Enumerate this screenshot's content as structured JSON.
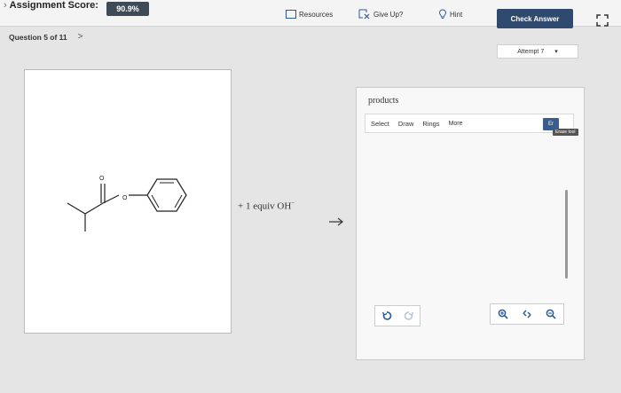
{
  "header": {
    "assignment_score_label": "Assignment Score:",
    "score": "90.9%",
    "resources_label": "Resources",
    "give_up_label": "Give Up?",
    "hint_label": "Hint",
    "check_answer_label": "Check Answer"
  },
  "question": {
    "position_label": "Question 5 of 11",
    "next_glyph": ">"
  },
  "attempt": {
    "label": "Attempt 7",
    "dropdown_glyph": "▾"
  },
  "reaction": {
    "reagent_text": "+ 1 equiv OH",
    "reagent_charge": "−",
    "carbonyl_oxygen": "O",
    "ester_oxygen": "O"
  },
  "products_panel": {
    "title": "products",
    "toolbar": [
      "Select",
      "Draw",
      "Rings",
      "More"
    ],
    "erase_button_label": "Er",
    "erase_tooltip": "Erase tool"
  },
  "colors": {
    "check_answer_bg": "#2f4a6e",
    "score_badge_bg": "#3e4a55",
    "accent_icon": "#2c5a97"
  },
  "icons": {
    "resources": "document-icon",
    "give_up": "give-up-icon",
    "hint": "lightbulb-icon",
    "expand": "expand-icon",
    "undo": "undo-icon",
    "redo": "redo-icon",
    "zoom_in": "zoom-in-icon",
    "reset": "reset-icon",
    "zoom_out": "zoom-out-icon"
  }
}
